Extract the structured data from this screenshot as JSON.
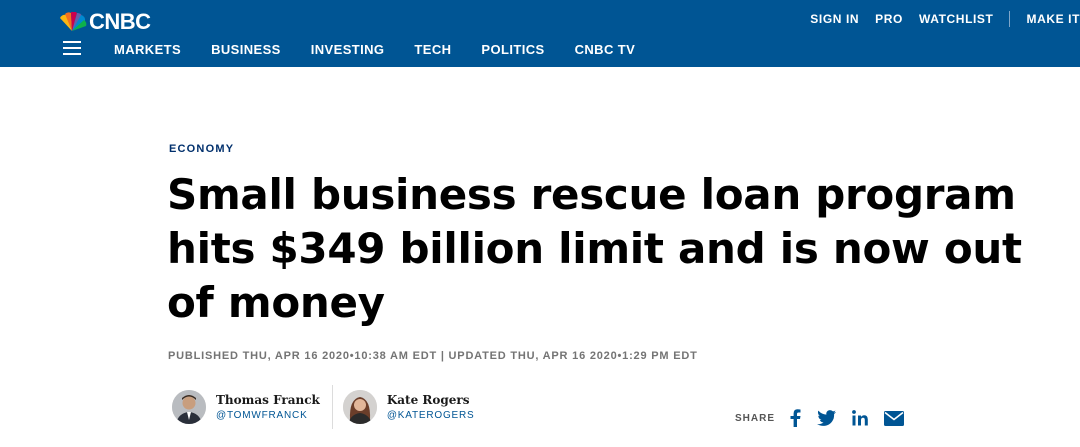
{
  "header": {
    "logo_text": "CNBC",
    "top_links": [
      "SIGN IN",
      "PRO",
      "WATCHLIST"
    ],
    "make_it_label": "MAKE IT",
    "nav": [
      "MARKETS",
      "BUSINESS",
      "INVESTING",
      "TECH",
      "POLITICS",
      "CNBC TV"
    ]
  },
  "article": {
    "category": "ECONOMY",
    "headline": "Small business rescue loan program hits $349 billion limit and is now out of money",
    "timestamps": "PUBLISHED THU, APR 16 2020•10:38 AM EDT | UPDATED THU, APR 16 2020•1:29 PM EDT"
  },
  "authors": [
    {
      "name": "Thomas Franck",
      "handle": "@TOMWFRANCK"
    },
    {
      "name": "Kate Rogers",
      "handle": "@KATEROGERS"
    }
  ],
  "share": {
    "label": "SHARE",
    "icons": [
      "facebook-icon",
      "twitter-icon",
      "linkedin-icon",
      "email-icon"
    ]
  },
  "colors": {
    "header_bg": "#005594",
    "category": "#002f6c",
    "icon_blue": "#005594"
  }
}
